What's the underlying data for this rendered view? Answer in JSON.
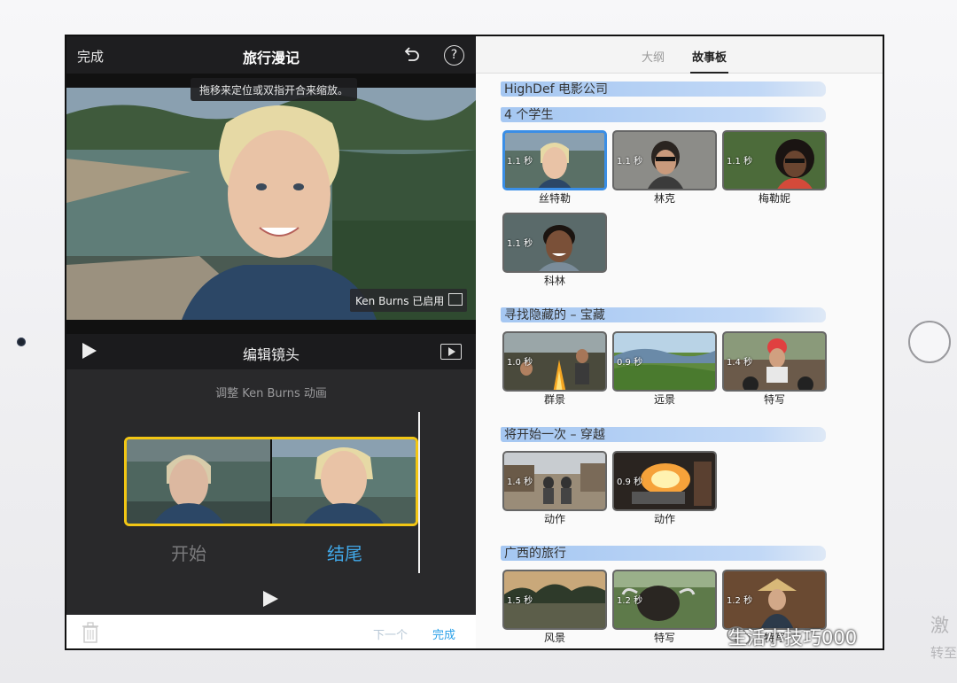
{
  "header": {
    "done_label": "完成",
    "title": "旅行漫记",
    "help_label": "?"
  },
  "viewer": {
    "hint": "拖移来定位或双指开合来缩放。",
    "ken_burns_badge": "Ken Burns 已启用"
  },
  "editbar": {
    "label": "编辑镜头"
  },
  "kenburns": {
    "adjust_label": "调整 Ken Burns 动画",
    "start_label": "开始",
    "end_label": "结尾"
  },
  "footer": {
    "next_label": "下一个",
    "done_label": "完成"
  },
  "tabs": [
    {
      "label": "大纲"
    },
    {
      "label": "故事板"
    }
  ],
  "storyboard": {
    "company": "HighDef 电影公司",
    "sections": [
      {
        "title": "4 个学生",
        "shots": [
          {
            "duration": "1.1 秒",
            "caption": "丝特勒"
          },
          {
            "duration": "1.1 秒",
            "caption": "林克"
          },
          {
            "duration": "1.1 秒",
            "caption": "梅勒妮"
          },
          {
            "duration": "1.1 秒",
            "caption": "科林"
          }
        ]
      },
      {
        "title": "寻找隐藏的 – 宝藏",
        "shots": [
          {
            "duration": "1.0 秒",
            "caption": "群景"
          },
          {
            "duration": "0.9 秒",
            "caption": "远景"
          },
          {
            "duration": "1.4 秒",
            "caption": "特写"
          }
        ]
      },
      {
        "title": "将开始一次 – 穿越",
        "shots": [
          {
            "duration": "1.4 秒",
            "caption": "动作"
          },
          {
            "duration": "0.9 秒",
            "caption": "动作"
          }
        ]
      },
      {
        "title": "广西的旅行",
        "shots": [
          {
            "duration": "1.5 秒",
            "caption": "风景"
          },
          {
            "duration": "1.2 秒",
            "caption": "特写"
          },
          {
            "duration": "1.2 秒",
            "caption": "特写"
          }
        ]
      }
    ]
  },
  "watermark": {
    "text": "生活小技巧000",
    "side_line1": "激",
    "side_line2": "转至"
  },
  "colors": {
    "accent_blue": "#41a8e8",
    "selection_yellow": "#f2c614",
    "section_stroke": "#9cc3f0"
  }
}
